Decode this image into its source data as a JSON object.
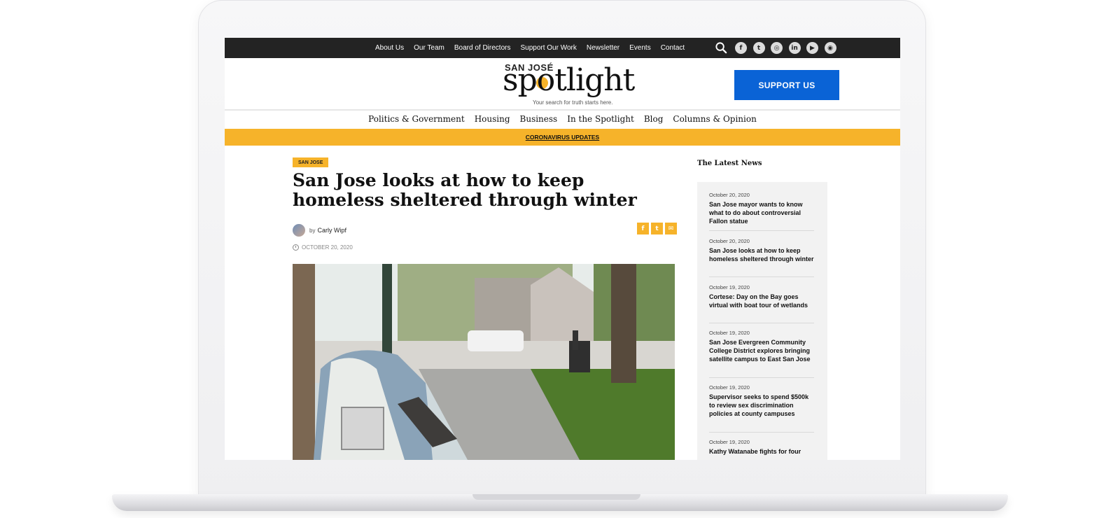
{
  "topbar": {
    "links": [
      "About Us",
      "Our Team",
      "Board of Directors",
      "Support Our Work",
      "Newsletter",
      "Events",
      "Contact"
    ],
    "social_icons": [
      "facebook-icon",
      "twitter-icon",
      "instagram-icon",
      "linkedin-icon",
      "youtube-icon",
      "rss-icon"
    ],
    "social_glyphs": [
      "f",
      "t",
      "◎",
      "in",
      "▶",
      "◉"
    ]
  },
  "header": {
    "logo_top": "SAN JOSÉ",
    "logo_main": "spotlight",
    "tagline": "Your search for truth starts here.",
    "support_label": "SUPPORT US"
  },
  "mainnav": {
    "items": [
      "Politics & Government",
      "Housing",
      "Business",
      "In the Spotlight",
      "Blog",
      "Columns & Opinion"
    ]
  },
  "alert": {
    "label": "CORONAVIRUS UPDATES"
  },
  "article": {
    "tag": "SAN JOSE",
    "title": "San Jose looks at how to keep homeless sheltered through winter",
    "by_prefix": "by",
    "author": "Carly Wipf",
    "date": "OCTOBER 20, 2020",
    "share_glyphs": [
      "f",
      "t",
      "✉"
    ]
  },
  "sidebar": {
    "heading": "The Latest News",
    "items": [
      {
        "date": "October 20, 2020",
        "title": "San Jose mayor wants to know what to do about controversial Fallon statue"
      },
      {
        "date": "October 20, 2020",
        "title": "San Jose looks at how to keep homeless sheltered through winter"
      },
      {
        "date": "October 19, 2020",
        "title": "Cortese: Day on the Bay goes virtual with boat tour of wetlands"
      },
      {
        "date": "October 19, 2020",
        "title": "San Jose Evergreen Community College District explores bringing satellite campus to East San Jose"
      },
      {
        "date": "October 19, 2020",
        "title": "Supervisor seeks to spend $500k to review sex discrimination policies at county campuses"
      },
      {
        "date": "October 19, 2020",
        "title": "Kathy Watanabe fights for four"
      }
    ]
  },
  "colors": {
    "accent": "#f6b32a",
    "button": "#0a63d6",
    "topbar": "#232323"
  }
}
